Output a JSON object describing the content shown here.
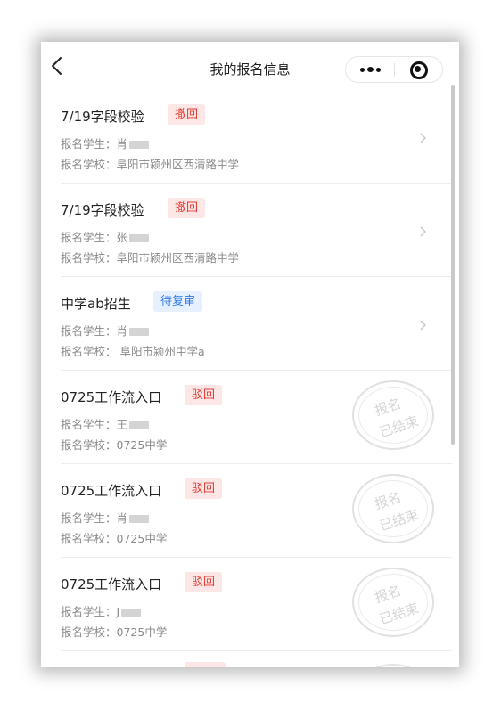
{
  "header": {
    "title": "我的报名信息",
    "back_icon": "chevron-left-icon",
    "more_icon": "more-dots-icon",
    "close_icon": "target-circle-icon"
  },
  "colors": {
    "badge_red_bg": "#fde7e6",
    "badge_red_text": "#e13b33",
    "badge_blue_bg": "#e6f0fe",
    "badge_blue_text": "#2f7bea",
    "stamp": "#dcdcdc"
  },
  "records": [
    {
      "title": "7/19字段校验",
      "status": "撤回",
      "status_color": "red",
      "student_label": "报名学生：",
      "student_value": "肖",
      "school_label": "报名学校：",
      "school_value": "阜阳市颍州区西清路中学",
      "stamp": null
    },
    {
      "title": "7/19字段校验",
      "status": "撤回",
      "status_color": "red",
      "student_label": "报名学生：",
      "student_value": "张",
      "school_label": "报名学校：",
      "school_value": "阜阳市颍州区西清路中学",
      "stamp": null
    },
    {
      "title": "中学ab招生",
      "status": "待复审",
      "status_color": "blue",
      "student_label": "报名学生：",
      "student_value": "肖",
      "school_label": "报名学校：",
      "school_value": " 阜阳市颍州中学a",
      "stamp": null
    },
    {
      "title": "0725工作流入口",
      "status": "驳回",
      "status_color": "red",
      "student_label": "报名学生：",
      "student_value": "王",
      "school_label": "报名学校：",
      "school_value": "0725中学",
      "stamp": {
        "line1": "报名",
        "line2": "已结束"
      }
    },
    {
      "title": "0725工作流入口",
      "status": "驳回",
      "status_color": "red",
      "student_label": "报名学生：",
      "student_value": "肖",
      "school_label": "报名学校：",
      "school_value": "0725中学",
      "stamp": {
        "line1": "报名",
        "line2": "已结束"
      }
    },
    {
      "title": "0725工作流入口",
      "status": "驳回",
      "status_color": "red",
      "student_label": "报名学生：",
      "student_value": "J",
      "school_label": "报名学校：",
      "school_value": "0725中学",
      "stamp": {
        "line1": "报名",
        "line2": "已结束"
      }
    }
  ]
}
